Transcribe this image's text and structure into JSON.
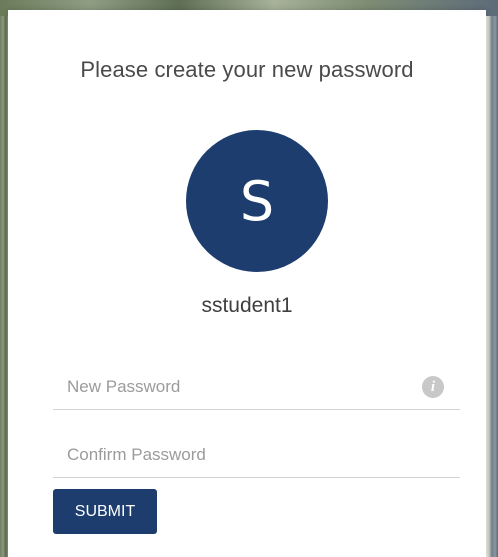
{
  "form": {
    "title": "Please create your new password",
    "avatar_letter": "S",
    "username": "sstudent1",
    "new_password": {
      "value": "",
      "placeholder": "New Password",
      "info_icon": "info-icon"
    },
    "confirm_password": {
      "value": "",
      "placeholder": "Confirm Password"
    },
    "submit_label": "SUBMIT"
  },
  "colors": {
    "accent": "#1c3d6e",
    "background": "#ffffff",
    "text": "#4a4a4a",
    "placeholder": "#9b9b9b"
  }
}
